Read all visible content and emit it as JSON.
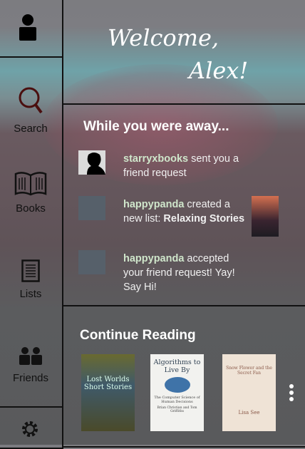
{
  "sidebar": {
    "items": [
      {
        "label": "Search",
        "icon": "search-icon"
      },
      {
        "label": "Books",
        "icon": "book-icon"
      },
      {
        "label": "Lists",
        "icon": "list-icon"
      },
      {
        "label": "Friends",
        "icon": "friends-icon"
      }
    ]
  },
  "header": {
    "line1": "Welcome,",
    "line2": "Alex!"
  },
  "away": {
    "title": "While you were away...",
    "items": [
      {
        "user": "happypanda",
        "text": " sent you a friend request",
        "user0": "starryxbooks"
      },
      {
        "user": "happypanda",
        "text": " created a new list: ",
        "bold": "Relaxing Stories"
      },
      {
        "user": "happypanda",
        "text": " accepted your friend request! Yay! Say Hi!"
      }
    ]
  },
  "reading": {
    "title": "Continue Reading",
    "books": [
      {
        "title": "Lost Worlds Short Stories",
        "color": "#4a5a3a"
      },
      {
        "title": "Algorithms to Live By",
        "subtitle": "The Computer Science of Human Decisions",
        "author": "Brian Christian and Tom Griffiths"
      },
      {
        "title": "Snow Flower and the Secret Fan",
        "author": "Lisa See"
      }
    ]
  }
}
